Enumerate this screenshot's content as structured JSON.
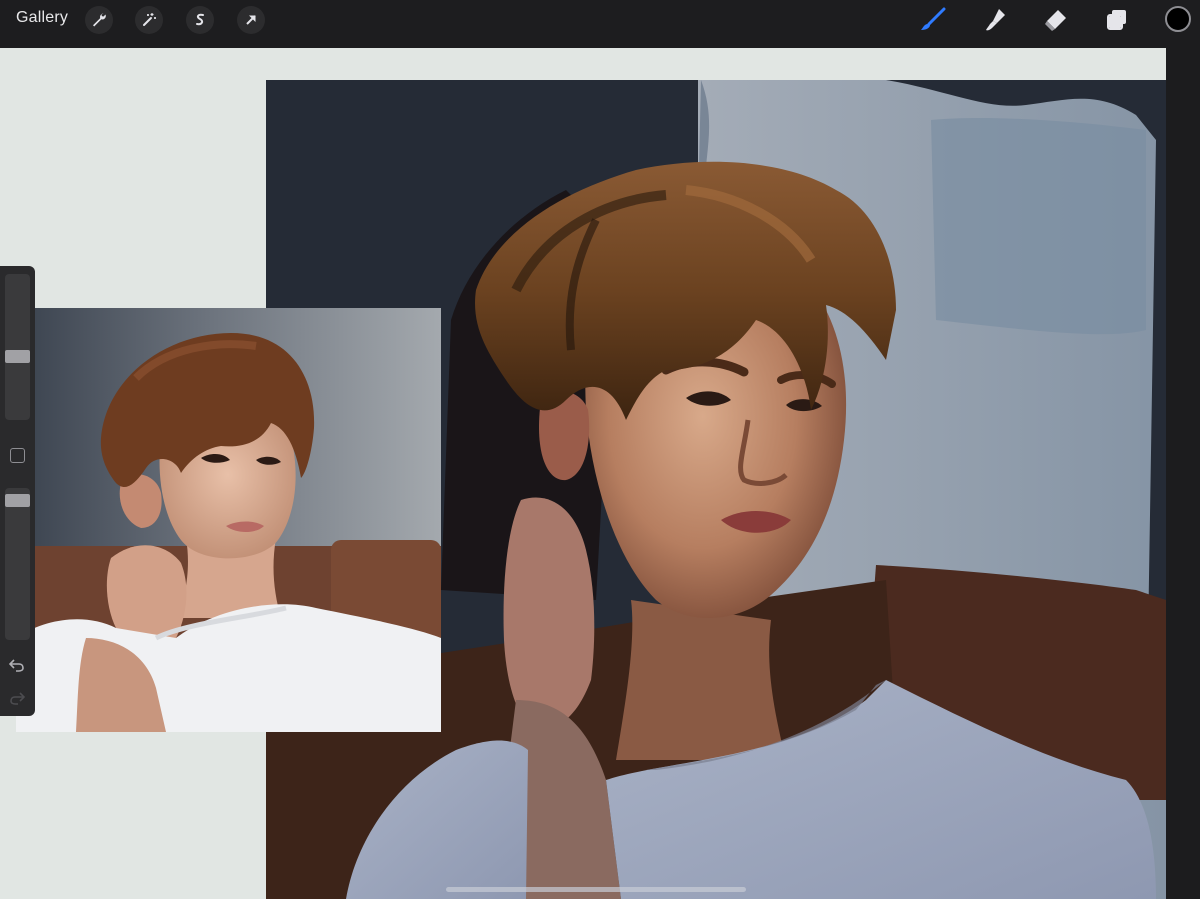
{
  "toolbar": {
    "gallery_label": "Gallery",
    "left_tools": [
      "wrench-icon",
      "magic-wand-icon",
      "selection-icon",
      "transform-arrow-icon"
    ],
    "right_tools": [
      "brush-icon",
      "smudge-icon",
      "eraser-icon",
      "layers-icon"
    ],
    "active_tool": "brush-icon",
    "active_tool_color": "#2f7bff",
    "current_color": "#000000"
  },
  "sidebar": {
    "size_slider_value": 0.6,
    "opacity_slider_value": 0.05,
    "controls": [
      "brush-size-slider",
      "modify-button",
      "opacity-slider",
      "undo-icon",
      "redo-icon"
    ]
  },
  "canvas": {
    "background_color": "#e1e6e3",
    "contents": [
      "reference-photo",
      "portrait-painting"
    ]
  }
}
